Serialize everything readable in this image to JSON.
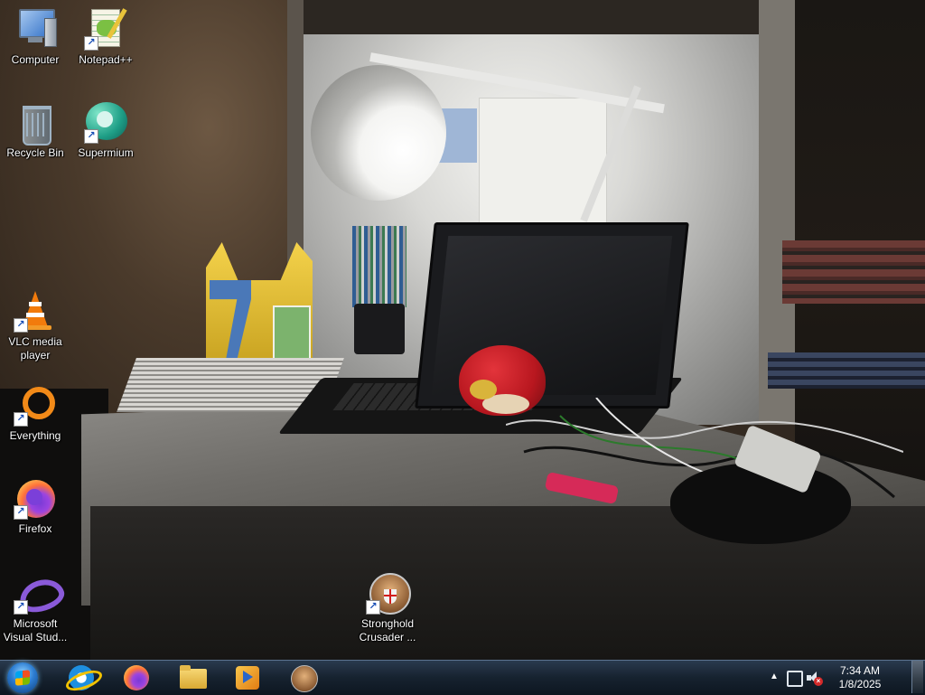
{
  "desktop": {
    "icons": [
      {
        "id": "computer",
        "label": "Computer",
        "icon": "computer-icon",
        "shortcut": false
      },
      {
        "id": "notepadpp",
        "label": "Notepad++",
        "icon": "notepadpp-icon",
        "shortcut": true
      },
      {
        "id": "recycle-bin",
        "label": "Recycle Bin",
        "icon": "recycle-bin-icon",
        "shortcut": false
      },
      {
        "id": "supermium",
        "label": "Supermium",
        "icon": "supermium-icon",
        "shortcut": true
      },
      {
        "id": "vlc",
        "label": "VLC media player",
        "icon": "vlc-icon",
        "shortcut": true
      },
      {
        "id": "everything",
        "label": "Everything",
        "icon": "everything-icon",
        "shortcut": true
      },
      {
        "id": "firefox",
        "label": "Firefox",
        "icon": "firefox-icon",
        "shortcut": true
      },
      {
        "id": "visual-studio",
        "label": "Microsoft Visual Stud...",
        "icon": "visual-studio-icon",
        "shortcut": true
      },
      {
        "id": "stronghold",
        "label": "Stronghold Crusader ...",
        "icon": "stronghold-icon",
        "shortcut": true
      }
    ],
    "shortcut_glyph": "↗"
  },
  "taskbar": {
    "start": {
      "icon": "start-orb-icon"
    },
    "pinned": [
      {
        "id": "internet-explorer",
        "icon": "internet-explorer-icon"
      },
      {
        "id": "firefox",
        "icon": "firefox-icon"
      },
      {
        "id": "explorer",
        "icon": "folder-icon"
      },
      {
        "id": "media-player",
        "icon": "media-player-icon"
      },
      {
        "id": "stronghold",
        "icon": "stronghold-icon"
      }
    ],
    "tray": {
      "show_hidden_glyph": "▲",
      "network_icon": "network-icon",
      "volume_icon": "volume-muted-icon",
      "volume_mute_glyph": "×",
      "time": "7:34 AM",
      "date": "1/8/2025"
    }
  },
  "colors": {
    "taskbar_bg": "#16222f",
    "icon_label": "#ffffff"
  }
}
